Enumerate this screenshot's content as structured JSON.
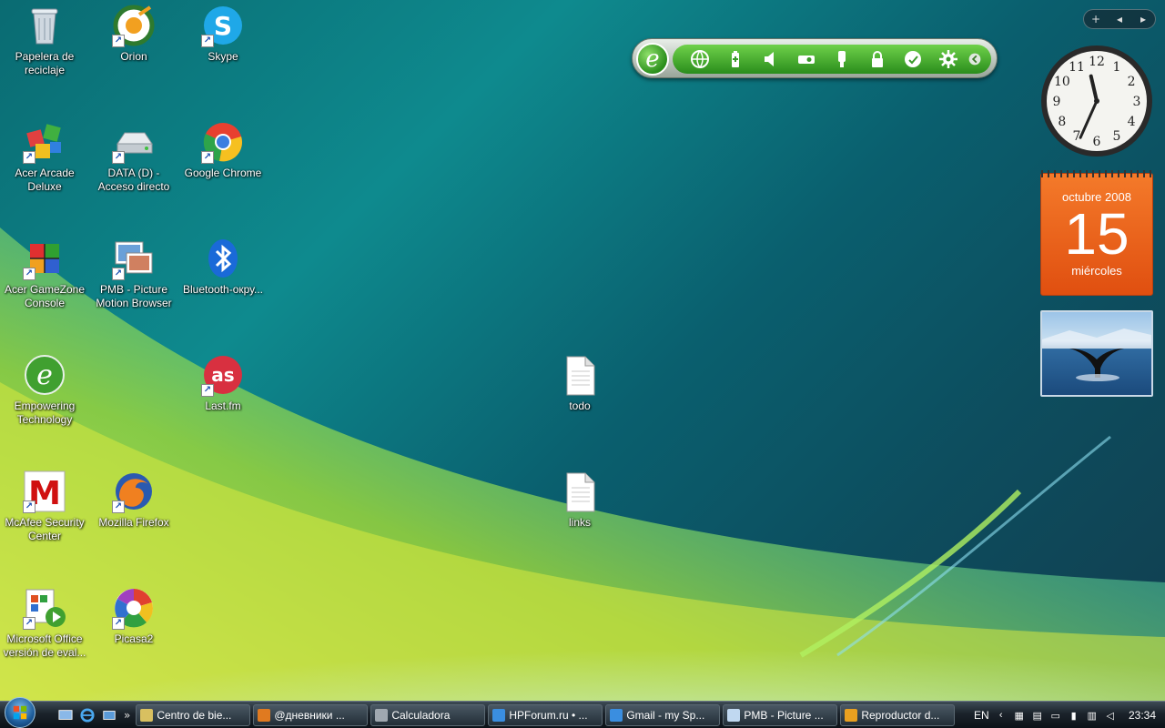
{
  "desktop": {
    "icons": [
      {
        "label": "Papelera de reciclaje",
        "icon": "recycle-bin-icon"
      },
      {
        "label": "Orion",
        "icon": "orion-icon"
      },
      {
        "label": "Skype",
        "icon": "skype-icon"
      },
      {
        "label": "Acer Arcade Deluxe",
        "icon": "acer-arcade-icon"
      },
      {
        "label": "DATA (D) - Acceso directo",
        "icon": "drive-icon"
      },
      {
        "label": "Google Chrome",
        "icon": "chrome-icon"
      },
      {
        "label": "Acer GameZone Console",
        "icon": "gamezone-icon"
      },
      {
        "label": "PMB - Picture Motion Browser",
        "icon": "pmb-icon"
      },
      {
        "label": "Bluetooth-окру...",
        "icon": "bluetooth-icon"
      },
      {
        "label": "Empowering Technology",
        "icon": "empowering-icon"
      },
      {
        "label": "Last.fm",
        "icon": "lastfm-icon"
      },
      {
        "label": "todo",
        "icon": "text-file-icon"
      },
      {
        "label": "McAfee Security Center",
        "icon": "mcafee-icon"
      },
      {
        "label": "Mozilla Firefox",
        "icon": "firefox-icon"
      },
      {
        "label": "links",
        "icon": "text-file-icon"
      },
      {
        "label": "Microsoft Office versión de eval...",
        "icon": "office-icon"
      },
      {
        "label": "Picasa2",
        "icon": "picasa-icon"
      }
    ]
  },
  "gadgets": {
    "empowering_bar": {
      "logo": "e",
      "buttons": [
        "globe-icon",
        "battery-icon",
        "speaker-icon",
        "projector-icon",
        "usb-key-icon",
        "lock-icon",
        "network-icon",
        "gear-icon",
        "collapse-icon"
      ]
    },
    "sidebar_controls": [
      "+",
      "◂",
      "▸"
    ],
    "clock": {
      "numbers": [
        "12",
        "1",
        "2",
        "3",
        "4",
        "5",
        "6",
        "7",
        "8",
        "9",
        "10",
        "11"
      ],
      "hour": 11,
      "minute": 34
    },
    "calendar": {
      "month": "octubre 2008",
      "day": "15",
      "weekday": "miércoles"
    },
    "slideshow": {
      "image": "whale-tail-photo"
    }
  },
  "taskbar": {
    "start": "windows-start-icon",
    "quick_launch": [
      "show-desktop-icon",
      "ie-icon",
      "switch-windows-icon"
    ],
    "more": "»",
    "tasks": [
      {
        "label": "Centro de bie...",
        "color": "#d8c060"
      },
      {
        "label": "@дневники ...",
        "color": "#e07a20"
      },
      {
        "label": "Calculadora",
        "color": "#a0a8b0"
      },
      {
        "label": "HPForum.ru • ...",
        "color": "#3a8ee0"
      },
      {
        "label": "Gmail - my Sp...",
        "color": "#3a8ee0"
      },
      {
        "label": "PMB - Picture ...",
        "color": "#c0d8f0"
      },
      {
        "label": "Reproductor d...",
        "color": "#e8a020"
      }
    ],
    "tray": {
      "language": "EN",
      "time": "23:34"
    }
  }
}
